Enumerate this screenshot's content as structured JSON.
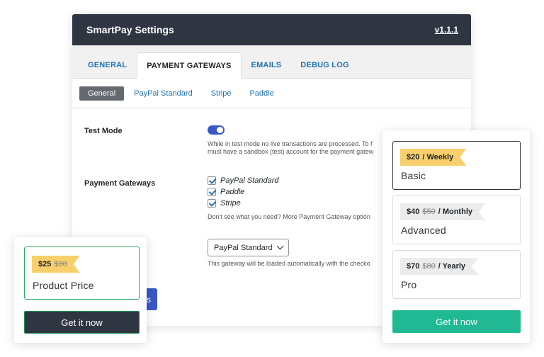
{
  "window": {
    "title": "SmartPay Settings",
    "version": "v1.1.1"
  },
  "tabs": [
    {
      "label": "GENERAL",
      "active": false
    },
    {
      "label": "PAYMENT GATEWAYS",
      "active": true
    },
    {
      "label": "EMAILS",
      "active": false
    },
    {
      "label": "DEBUG LOG",
      "active": false
    }
  ],
  "subtabs": [
    {
      "label": "General",
      "active": true
    },
    {
      "label": "PayPal Standard",
      "active": false
    },
    {
      "label": "Stripe",
      "active": false
    },
    {
      "label": "Paddle",
      "active": false
    }
  ],
  "test_mode": {
    "label": "Test Mode",
    "enabled": true,
    "help_line1": "While in test mode no live transactions are processed. To f",
    "help_line2": "must have a sandbox (test) account for the payment gatew"
  },
  "payment_gateways": {
    "label": "Payment Gateways",
    "options": [
      {
        "label": "PayPal Standard",
        "checked": true
      },
      {
        "label": "Paddle",
        "checked": true
      },
      {
        "label": "Stripe",
        "checked": true
      }
    ],
    "help": "Don't see what you need? More Payment Gateway option"
  },
  "default_gateway": {
    "selected": "PayPal Standard",
    "help": "This gateway will be loaded automatically with the checko"
  },
  "save_button": {
    "label": "s"
  },
  "product_card": {
    "price": "$25",
    "old_price": "$30",
    "name": "Product Price",
    "button": "Get it now"
  },
  "plans_card": {
    "plans": [
      {
        "price": "$20",
        "old_price": "",
        "period": "/ Weekly",
        "name": "Basic",
        "selected": true
      },
      {
        "price": "$40",
        "old_price": "$50",
        "period": "/ Monthly",
        "name": "Advanced",
        "selected": false
      },
      {
        "price": "$70",
        "old_price": "$80",
        "period": "/ Yearly",
        "name": "Pro",
        "selected": false
      }
    ],
    "button": "Get it now"
  },
  "colors": {
    "header": "#2f3541",
    "accent_blue": "#3858c8",
    "link_blue": "#2271b1",
    "ribbon_yellow": "#f9cf6b",
    "ribbon_gray": "#ececec",
    "green_button": "#20b993",
    "selected_border": "#2fa565"
  }
}
